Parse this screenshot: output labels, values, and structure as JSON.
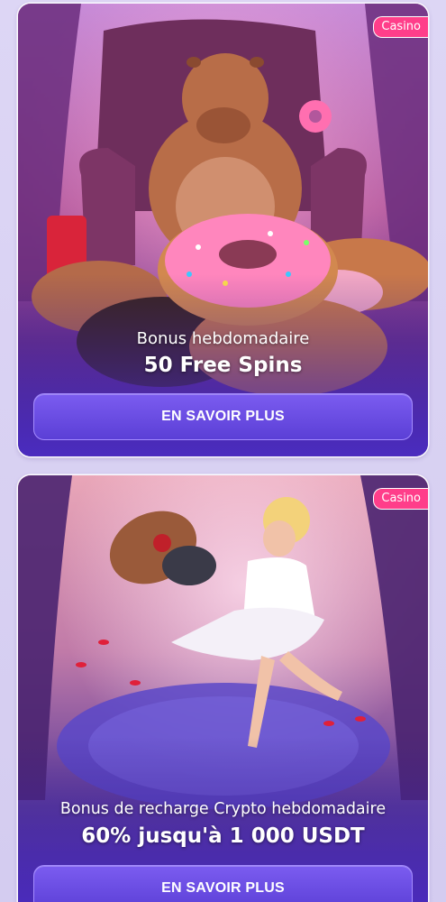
{
  "promos": [
    {
      "badge": "Casino",
      "subtitle": "Bonus hebdomadaire",
      "title": "50 Free Spins",
      "button_label": "EN SAVOIR PLUS"
    },
    {
      "badge": "Casino",
      "subtitle": "Bonus de recharge Crypto hebdomadaire",
      "title": "60% jusqu'à 1 000 USDT",
      "button_label": "EN SAVOIR PLUS"
    }
  ],
  "colors": {
    "badge": "#ff3e8a",
    "button": "#6a4ce6",
    "page_background": "#d9d2f3"
  }
}
